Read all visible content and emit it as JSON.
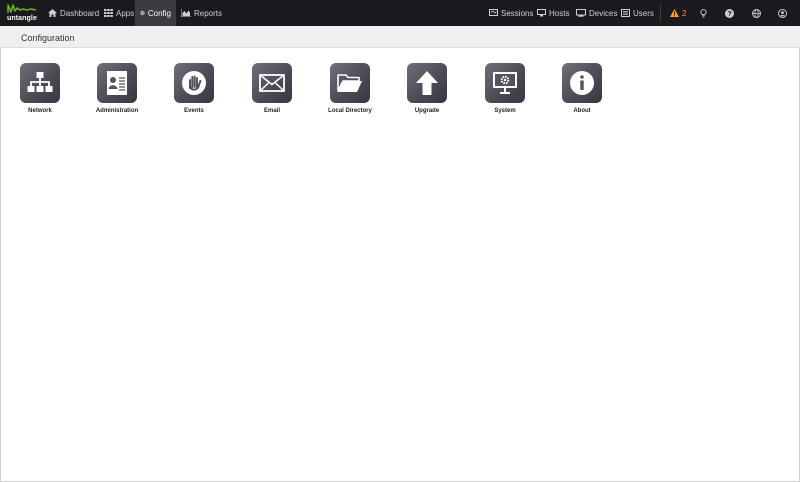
{
  "brand": {
    "name": "untangle",
    "accent": "#6ab023"
  },
  "nav": {
    "left": [
      {
        "label": "Dashboard",
        "icon": "home-icon",
        "active": false
      },
      {
        "label": "Apps",
        "icon": "grid-icon",
        "active": false
      },
      {
        "label": "Config",
        "icon": "gear-icon",
        "active": true
      },
      {
        "label": "Reports",
        "icon": "chart-icon",
        "active": false
      }
    ],
    "right": [
      {
        "label": "Sessions",
        "icon": "sessions-icon"
      },
      {
        "label": "Hosts",
        "icon": "hosts-icon"
      },
      {
        "label": "Devices",
        "icon": "devices-icon"
      },
      {
        "label": "Users",
        "icon": "users-icon"
      }
    ],
    "alerts": {
      "count": "2",
      "icon": "warning-icon",
      "color": "#ff9f1a"
    },
    "utility_icons": [
      "lightbulb-icon",
      "help-icon",
      "globe-icon",
      "account-icon"
    ]
  },
  "page": {
    "title": "Configuration"
  },
  "tiles": [
    {
      "label": "Network",
      "icon": "network-icon"
    },
    {
      "label": "Administration",
      "icon": "administration-icon"
    },
    {
      "label": "Events",
      "icon": "hand-icon"
    },
    {
      "label": "Email",
      "icon": "envelope-icon"
    },
    {
      "label": "Local Directory",
      "icon": "folder-icon"
    },
    {
      "label": "Upgrade",
      "icon": "arrow-up-icon"
    },
    {
      "label": "System",
      "icon": "monitor-gear-icon"
    },
    {
      "label": "About",
      "icon": "info-icon"
    }
  ]
}
